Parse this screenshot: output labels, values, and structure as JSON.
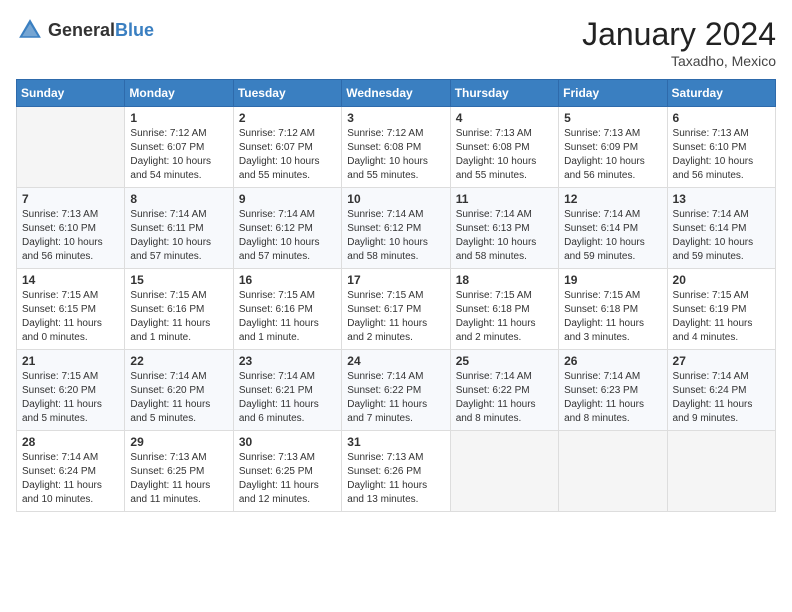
{
  "header": {
    "logo_general": "General",
    "logo_blue": "Blue",
    "month_year": "January 2024",
    "location": "Taxadho, Mexico"
  },
  "weekdays": [
    "Sunday",
    "Monday",
    "Tuesday",
    "Wednesday",
    "Thursday",
    "Friday",
    "Saturday"
  ],
  "weeks": [
    [
      {
        "day": "",
        "info": ""
      },
      {
        "day": "1",
        "info": "Sunrise: 7:12 AM\nSunset: 6:07 PM\nDaylight: 10 hours\nand 54 minutes."
      },
      {
        "day": "2",
        "info": "Sunrise: 7:12 AM\nSunset: 6:07 PM\nDaylight: 10 hours\nand 55 minutes."
      },
      {
        "day": "3",
        "info": "Sunrise: 7:12 AM\nSunset: 6:08 PM\nDaylight: 10 hours\nand 55 minutes."
      },
      {
        "day": "4",
        "info": "Sunrise: 7:13 AM\nSunset: 6:08 PM\nDaylight: 10 hours\nand 55 minutes."
      },
      {
        "day": "5",
        "info": "Sunrise: 7:13 AM\nSunset: 6:09 PM\nDaylight: 10 hours\nand 56 minutes."
      },
      {
        "day": "6",
        "info": "Sunrise: 7:13 AM\nSunset: 6:10 PM\nDaylight: 10 hours\nand 56 minutes."
      }
    ],
    [
      {
        "day": "7",
        "info": "Sunrise: 7:13 AM\nSunset: 6:10 PM\nDaylight: 10 hours\nand 56 minutes."
      },
      {
        "day": "8",
        "info": "Sunrise: 7:14 AM\nSunset: 6:11 PM\nDaylight: 10 hours\nand 57 minutes."
      },
      {
        "day": "9",
        "info": "Sunrise: 7:14 AM\nSunset: 6:12 PM\nDaylight: 10 hours\nand 57 minutes."
      },
      {
        "day": "10",
        "info": "Sunrise: 7:14 AM\nSunset: 6:12 PM\nDaylight: 10 hours\nand 58 minutes."
      },
      {
        "day": "11",
        "info": "Sunrise: 7:14 AM\nSunset: 6:13 PM\nDaylight: 10 hours\nand 58 minutes."
      },
      {
        "day": "12",
        "info": "Sunrise: 7:14 AM\nSunset: 6:14 PM\nDaylight: 10 hours\nand 59 minutes."
      },
      {
        "day": "13",
        "info": "Sunrise: 7:14 AM\nSunset: 6:14 PM\nDaylight: 10 hours\nand 59 minutes."
      }
    ],
    [
      {
        "day": "14",
        "info": "Sunrise: 7:15 AM\nSunset: 6:15 PM\nDaylight: 11 hours\nand 0 minutes."
      },
      {
        "day": "15",
        "info": "Sunrise: 7:15 AM\nSunset: 6:16 PM\nDaylight: 11 hours\nand 1 minute."
      },
      {
        "day": "16",
        "info": "Sunrise: 7:15 AM\nSunset: 6:16 PM\nDaylight: 11 hours\nand 1 minute."
      },
      {
        "day": "17",
        "info": "Sunrise: 7:15 AM\nSunset: 6:17 PM\nDaylight: 11 hours\nand 2 minutes."
      },
      {
        "day": "18",
        "info": "Sunrise: 7:15 AM\nSunset: 6:18 PM\nDaylight: 11 hours\nand 2 minutes."
      },
      {
        "day": "19",
        "info": "Sunrise: 7:15 AM\nSunset: 6:18 PM\nDaylight: 11 hours\nand 3 minutes."
      },
      {
        "day": "20",
        "info": "Sunrise: 7:15 AM\nSunset: 6:19 PM\nDaylight: 11 hours\nand 4 minutes."
      }
    ],
    [
      {
        "day": "21",
        "info": "Sunrise: 7:15 AM\nSunset: 6:20 PM\nDaylight: 11 hours\nand 5 minutes."
      },
      {
        "day": "22",
        "info": "Sunrise: 7:14 AM\nSunset: 6:20 PM\nDaylight: 11 hours\nand 5 minutes."
      },
      {
        "day": "23",
        "info": "Sunrise: 7:14 AM\nSunset: 6:21 PM\nDaylight: 11 hours\nand 6 minutes."
      },
      {
        "day": "24",
        "info": "Sunrise: 7:14 AM\nSunset: 6:22 PM\nDaylight: 11 hours\nand 7 minutes."
      },
      {
        "day": "25",
        "info": "Sunrise: 7:14 AM\nSunset: 6:22 PM\nDaylight: 11 hours\nand 8 minutes."
      },
      {
        "day": "26",
        "info": "Sunrise: 7:14 AM\nSunset: 6:23 PM\nDaylight: 11 hours\nand 8 minutes."
      },
      {
        "day": "27",
        "info": "Sunrise: 7:14 AM\nSunset: 6:24 PM\nDaylight: 11 hours\nand 9 minutes."
      }
    ],
    [
      {
        "day": "28",
        "info": "Sunrise: 7:14 AM\nSunset: 6:24 PM\nDaylight: 11 hours\nand 10 minutes."
      },
      {
        "day": "29",
        "info": "Sunrise: 7:13 AM\nSunset: 6:25 PM\nDaylight: 11 hours\nand 11 minutes."
      },
      {
        "day": "30",
        "info": "Sunrise: 7:13 AM\nSunset: 6:25 PM\nDaylight: 11 hours\nand 12 minutes."
      },
      {
        "day": "31",
        "info": "Sunrise: 7:13 AM\nSunset: 6:26 PM\nDaylight: 11 hours\nand 13 minutes."
      },
      {
        "day": "",
        "info": ""
      },
      {
        "day": "",
        "info": ""
      },
      {
        "day": "",
        "info": ""
      }
    ]
  ]
}
